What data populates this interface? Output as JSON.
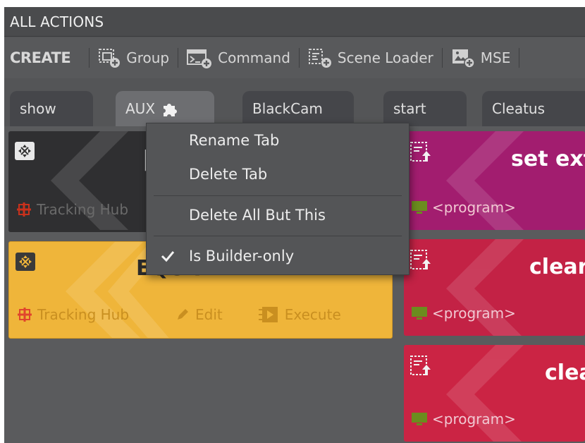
{
  "window": {
    "title": "ALL ACTIONS"
  },
  "toolbar": {
    "create_label": "CREATE",
    "buttons": [
      {
        "label": "Group",
        "icon": "group-add-icon"
      },
      {
        "label": "Command",
        "icon": "command-add-icon"
      },
      {
        "label": "Scene Loader",
        "icon": "scene-loader-add-icon"
      },
      {
        "label": "MSE",
        "icon": "mse-add-icon"
      }
    ]
  },
  "tabs": [
    {
      "label": "show",
      "active": false
    },
    {
      "label": "AUX",
      "active": true,
      "icon": "puzzle-icon"
    },
    {
      "label": "BlackCam",
      "active": false
    },
    {
      "label": "start",
      "active": false
    },
    {
      "label": "Cleatus",
      "active": false
    }
  ],
  "context_menu": {
    "items": [
      {
        "label": "Rename Tab"
      },
      {
        "label": "Delete Tab"
      },
      {
        "label": "Delete All But This"
      },
      {
        "label": "Is Builder-only",
        "checked": true
      }
    ]
  },
  "cards": {
    "dark": {
      "title_partial": "|",
      "source": "Tracking Hub",
      "color": "#2f2f31"
    },
    "yellow": {
      "title": "EQUIPMENT",
      "source": "Tracking Hub",
      "edit_label": "Edit",
      "execute_label": "Execute",
      "color": "#efb53a"
    },
    "magenta": {
      "title": "set ext",
      "program": "<program>",
      "color": "#a21d6f"
    },
    "red1": {
      "title": "clear",
      "program": "<program>",
      "color": "#c32245"
    },
    "red2": {
      "title": "clea",
      "program": "<program>",
      "color": "#cb2444"
    }
  },
  "colors": {
    "accent_red": "#e0452c",
    "program_icon": "#6b8c1e"
  }
}
